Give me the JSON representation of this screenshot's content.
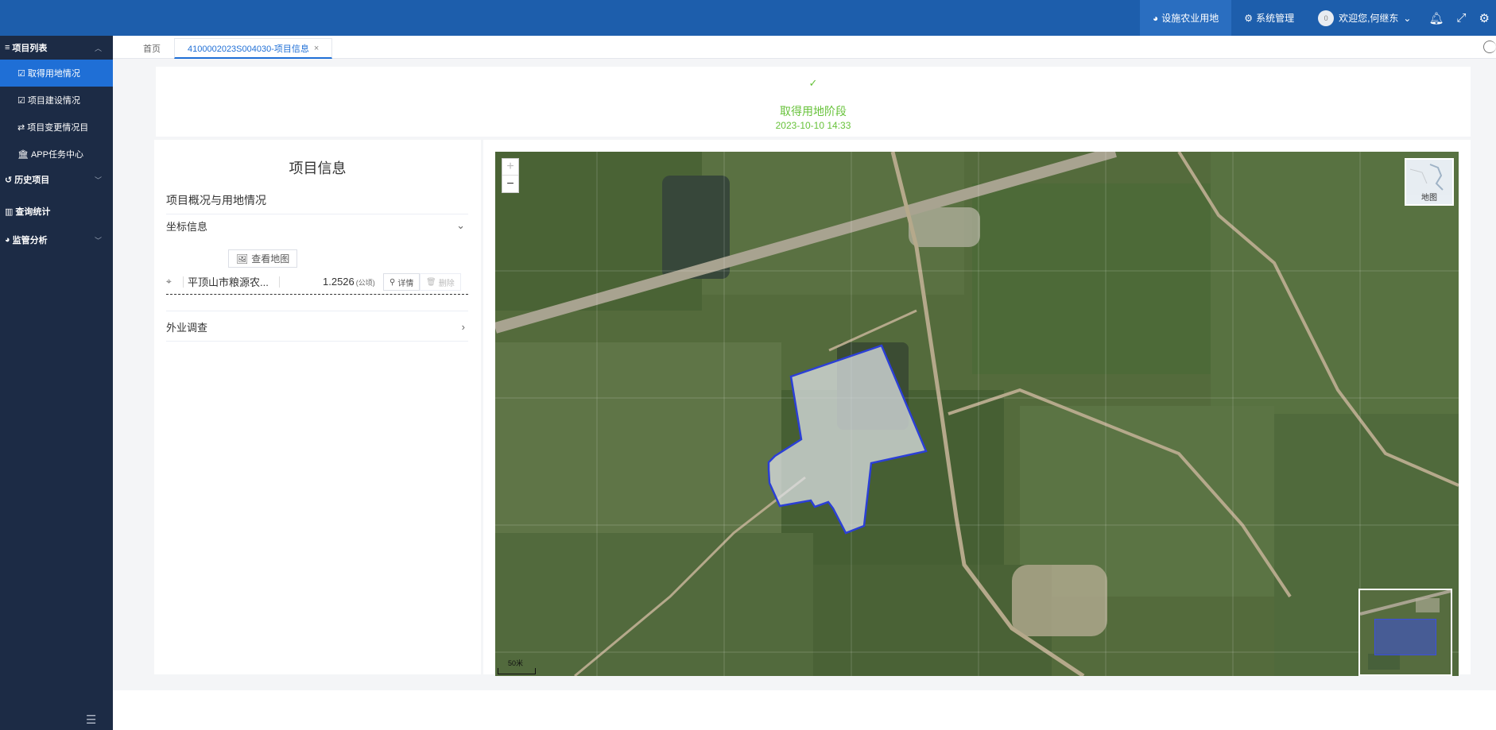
{
  "topbar": {
    "nav_facility": "设施农业用地",
    "nav_system": "系统管理",
    "welcome": "欢迎您,何继东",
    "avatar_text": "0"
  },
  "sidebar": {
    "groups": [
      {
        "label": "项目列表",
        "expanded": true
      },
      {
        "label": "历史项目",
        "expanded": false
      },
      {
        "label": "查询统计"
      },
      {
        "label": "监管分析",
        "expanded": false
      }
    ],
    "items": [
      {
        "label": "取得用地情况",
        "active": true
      },
      {
        "label": "项目建设情况"
      },
      {
        "label": "项目变更情况目"
      },
      {
        "label": "APP任务中心"
      }
    ]
  },
  "tabs": {
    "home": "首页",
    "active": "4100002023S004030-项目信息"
  },
  "stage": {
    "title": "取得用地阶段",
    "date": "2023-10-10 14:33"
  },
  "info": {
    "title": "项目信息",
    "subtitle": "项目概况与用地情况",
    "coord_section": "坐标信息",
    "view_map_button": "查看地图",
    "coord_row": {
      "name": "平顶山市粮源农...",
      "area": "1.2526",
      "unit": "(公顷)",
      "detail": "详情",
      "delete": "删除"
    },
    "survey_section": "外业调查"
  },
  "map": {
    "zoom_in": "+",
    "zoom_out": "−",
    "layer_label": "地图",
    "scale_label": "50米"
  },
  "colors": {
    "topbar": "#1d5eac",
    "sidebar": "#1c2b45",
    "accent": "#1f6fd6",
    "success": "#67c23a",
    "polygon_stroke": "#2b3fd6"
  }
}
